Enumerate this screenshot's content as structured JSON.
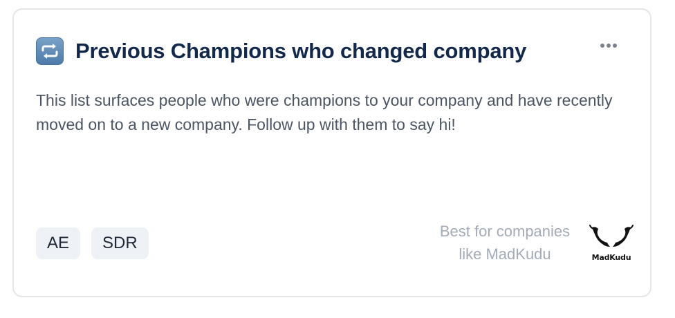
{
  "card": {
    "title": "Previous Champions who changed company",
    "title_icon": "repeat-arrows-icon",
    "menu_icon": "more-horizontal-icon",
    "description": "This list surfaces people who were champions to your company and have recently moved on to a new company. Follow up with them to say hi!",
    "tags": [
      {
        "label": "AE"
      },
      {
        "label": "SDR"
      }
    ],
    "best_for": {
      "line1": "Best for companies",
      "line2": "like MadKudu"
    },
    "logo": {
      "text": "MadKudu",
      "icon": "madkudu-logo"
    }
  },
  "colors": {
    "title": "#13294b",
    "body_text": "#4b5563",
    "muted_text": "#a3abb8",
    "tag_background": "#eef1f5",
    "card_border": "#e3e6ea",
    "icon_blue": "#5f8ab5"
  }
}
